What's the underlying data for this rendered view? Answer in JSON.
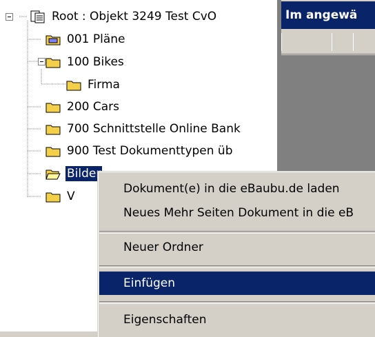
{
  "tree": {
    "root": {
      "label": "Root : Objekt 3249 Test CvO"
    },
    "nodes": [
      {
        "label": "001 Pläne"
      },
      {
        "label": "100 Bikes"
      },
      {
        "label": "Firma"
      },
      {
        "label": "200 Cars"
      },
      {
        "label": "700 Schnittstelle Online Bank"
      },
      {
        "label": "900 Test Dokumenttypen üb"
      },
      {
        "label": "Bilder"
      },
      {
        "label": "V"
      }
    ]
  },
  "right_pane": {
    "title": "Im angewä"
  },
  "context_menu": {
    "items": [
      {
        "label": "Dokument(e) in die eBaubu.de laden"
      },
      {
        "label": "Neues Mehr Seiten Dokument in die eB"
      },
      {
        "label": "Neuer Ordner"
      },
      {
        "label": "Einfügen"
      },
      {
        "label": "Eigenschaften"
      }
    ]
  },
  "colors": {
    "selection": "#0a246a",
    "folder": "#f4d04a",
    "face": "#d4d0c8"
  }
}
